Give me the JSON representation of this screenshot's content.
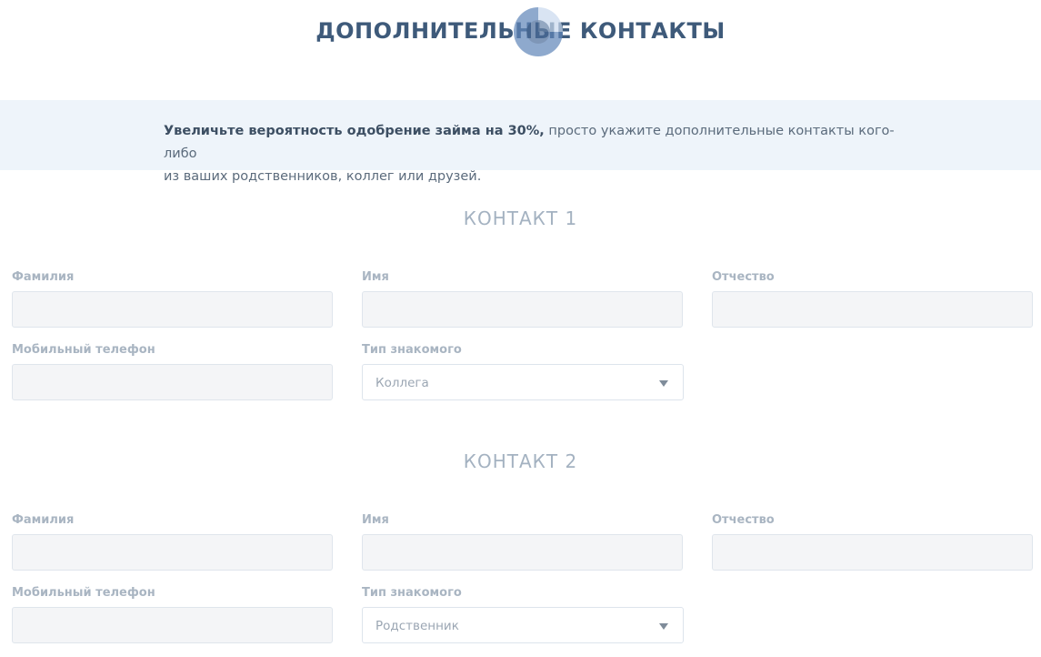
{
  "page_title": "ДОПОЛНИТЕЛЬНЫЕ КОНТАКТЫ",
  "notice": {
    "bold": "Увеличьте вероятность одобрение займа на 30%,",
    "rest": " просто укажите дополнительные контакты кого-либо",
    "line2": "из ваших родственников, коллег или друзей."
  },
  "contacts": [
    {
      "title": "КОНТАКТ 1",
      "labels": {
        "last_name": "Фамилия",
        "first_name": "Имя",
        "middle_name": "Отчество",
        "phone": "Мобильный телефон",
        "relation": "Тип знакомого"
      },
      "values": {
        "last_name": "",
        "first_name": "",
        "middle_name": "",
        "phone": ""
      },
      "relation_selected": "Коллега"
    },
    {
      "title": "КОНТАКТ 2",
      "labels": {
        "last_name": "Фамилия",
        "first_name": "Имя",
        "middle_name": "Отчество",
        "phone": "Мобильный телефон",
        "relation": "Тип знакомого"
      },
      "values": {
        "last_name": "",
        "first_name": "",
        "middle_name": "",
        "phone": ""
      },
      "relation_selected": "Родственник"
    }
  ],
  "icons": {
    "loading": "loading-spinner-icon",
    "dropdown": "caret-down-icon"
  },
  "colors": {
    "title": "#3e5a7a",
    "notice_bg": "#eef4fa",
    "label": "#a9b5c2",
    "input_bg": "#f4f5f7"
  }
}
